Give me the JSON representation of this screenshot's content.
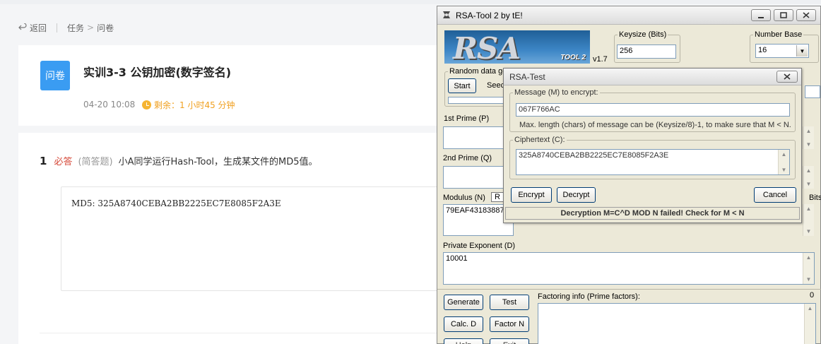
{
  "web": {
    "nav": {
      "back": "返回",
      "crumb_task": "任务",
      "crumb_arrow": ">",
      "crumb_current": "问卷"
    },
    "task": {
      "badge": "问卷",
      "title": "实训3-3 公钥加密(数字签名)",
      "date": "04-20 10:08",
      "remaining": "剩余：1 小时45 分钟"
    },
    "question": {
      "number": "1",
      "required": "必答",
      "type": "(简答题)",
      "text": "小A同学运行Hash-Tool，生成某文件的MD5值。",
      "answer": "MD5: 325A8740CEBA2BB2225EC7E8085F2A3E"
    }
  },
  "rsa_tool": {
    "title": "RSA-Tool 2 by tE!",
    "logo_big": "RSA",
    "logo_small": "TOOL 2",
    "version": "v1.7",
    "keysize_label": "Keysize (Bits)",
    "keysize_value": "256",
    "number_base_label": "Number Base",
    "number_base_value": "16",
    "random_label": "Random data ge",
    "start_label": "Start",
    "seed_label": "Seec",
    "prime1_label": "1st Prime (P)",
    "prime2_label": "2nd Prime (Q)",
    "modulus_label": "Modulus (N)",
    "modulus_r": "R",
    "modulus_value": "79EAF43183887",
    "bits_label": "Bits",
    "private_exp_label": "Private Exponent (D)",
    "private_exp_value": "10001",
    "factoring_label": "Factoring info (Prime factors):",
    "factoring_count": "0",
    "btn_generate": "Generate",
    "btn_test": "Test",
    "btn_calc_d": "Calc. D",
    "btn_factor_n": "Factor N",
    "btn_help_partial": "Help",
    "btn_exit_partial": "Exit"
  },
  "rsa_test": {
    "title": "RSA-Test",
    "message_label": "Message (M) to encrypt:",
    "message_value": "067F766AC",
    "max_len_note": "Max. length (chars) of message can be (Keysize/8)-1, to make sure that M < N.",
    "ciphertext_label": "Ciphertext (C):",
    "ciphertext_value": "325A8740CEBA2BB2225EC7E8085F2A3E",
    "btn_encrypt": "Encrypt",
    "btn_decrypt": "Decrypt",
    "btn_cancel": "Cancel",
    "status": "Decryption M=C^D MOD N failed! Check for M < N"
  }
}
